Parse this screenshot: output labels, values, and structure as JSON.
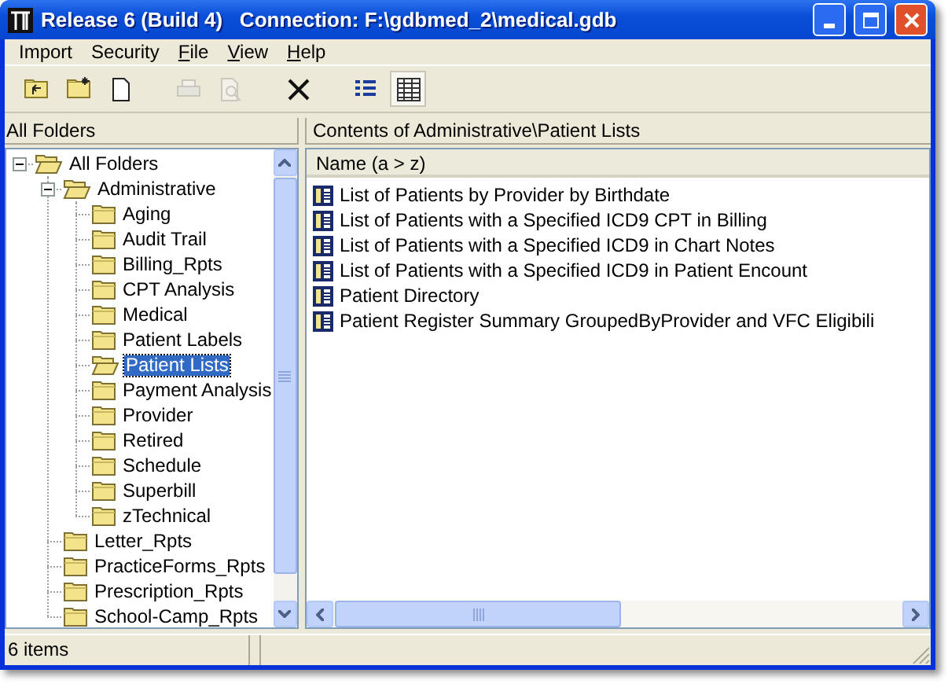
{
  "window": {
    "title": "Release 6 (Build 4)   Connection: F:\\gdbmed_2\\medical.gdb"
  },
  "menu": [
    {
      "label": "Import",
      "mnemonic": false
    },
    {
      "label": "Security",
      "mnemonic": false
    },
    {
      "label": "File",
      "mnemonic": true
    },
    {
      "label": "View",
      "mnemonic": true
    },
    {
      "label": "Help",
      "mnemonic": true
    }
  ],
  "toolbar": [
    {
      "kind": "folder-up",
      "disabled": false,
      "selected": false
    },
    {
      "kind": "new-folder",
      "disabled": false,
      "selected": false
    },
    {
      "kind": "new-document",
      "disabled": false,
      "selected": false
    },
    {
      "kind": "print",
      "disabled": true,
      "selected": false
    },
    {
      "kind": "preview",
      "disabled": true,
      "selected": false
    },
    {
      "kind": "delete",
      "disabled": false,
      "selected": false
    },
    {
      "kind": "list-view",
      "disabled": false,
      "selected": false
    },
    {
      "kind": "details-view",
      "disabled": false,
      "selected": true
    }
  ],
  "folders_pane": {
    "header": "All Folders",
    "tree": [
      {
        "label": "All Folders",
        "expanded": true,
        "selected": false,
        "children": [
          {
            "label": "Administrative",
            "expanded": true,
            "selected": false,
            "children": [
              {
                "label": "Aging",
                "selected": false
              },
              {
                "label": "Audit Trail",
                "selected": false
              },
              {
                "label": "Billing_Rpts",
                "selected": false
              },
              {
                "label": "CPT Analysis",
                "selected": false
              },
              {
                "label": "Medical",
                "selected": false
              },
              {
                "label": "Patient Labels",
                "selected": false
              },
              {
                "label": "Patient Lists",
                "selected": true
              },
              {
                "label": "Payment Analysis",
                "selected": false
              },
              {
                "label": "Provider",
                "selected": false
              },
              {
                "label": "Retired",
                "selected": false
              },
              {
                "label": "Schedule",
                "selected": false
              },
              {
                "label": "Superbill",
                "selected": false
              },
              {
                "label": "zTechnical",
                "selected": false
              }
            ]
          },
          {
            "label": "Letter_Rpts",
            "selected": false
          },
          {
            "label": "PracticeForms_Rpts",
            "selected": false
          },
          {
            "label": "Prescription_Rpts",
            "selected": false
          },
          {
            "label": "School-Camp_Rpts",
            "selected": false
          }
        ]
      }
    ]
  },
  "contents_pane": {
    "header": "Contents of Administrative\\Patient Lists",
    "column": "Name (a > z)",
    "items": [
      "List of Patients by Provider by Birthdate",
      "List of Patients with a Specified ICD9 CPT in Billing",
      "List of Patients with a Specified ICD9 in Chart Notes",
      "List of Patients with a Specified ICD9 in Patient Encount",
      "Patient Directory",
      "Patient Register Summary GroupedByProvider and VFC Eligibili"
    ]
  },
  "status_bar": {
    "text": "6 items"
  }
}
